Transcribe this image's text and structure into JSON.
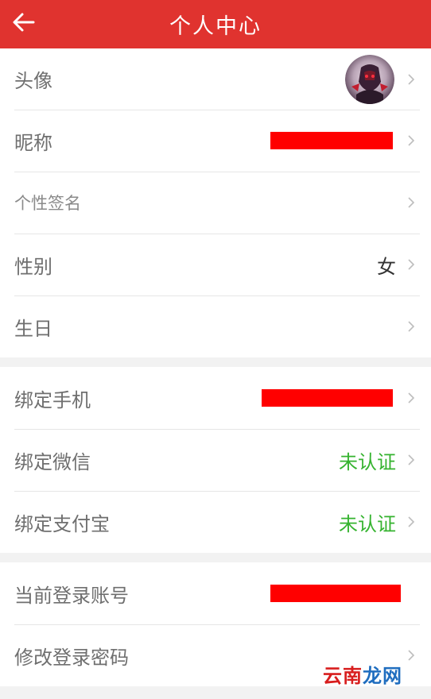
{
  "header": {
    "title": "个人中心"
  },
  "group1": [
    {
      "label": "头像",
      "type": "avatar"
    },
    {
      "label": "昵称",
      "type": "redacted"
    },
    {
      "label": "个性签名",
      "type": "empty"
    },
    {
      "label": "性别",
      "value": "女"
    },
    {
      "label": "生日",
      "type": "empty"
    }
  ],
  "group2": [
    {
      "label": "绑定手机",
      "type": "redacted"
    },
    {
      "label": "绑定微信",
      "value": "未认证"
    },
    {
      "label": "绑定支付宝",
      "value": "未认证"
    }
  ],
  "group3": [
    {
      "label": "当前登录账号",
      "type": "redacted"
    },
    {
      "label": "修改登录密码",
      "type": "empty"
    }
  ],
  "colors": {
    "header": "#e0332f",
    "accent_green": "#35b32f",
    "redaction": "#ff0000"
  },
  "icons": {
    "back": "arrow-left-icon",
    "row": "chevron-right-icon"
  },
  "watermark": {
    "part1": "云南",
    "part2": "龙网"
  }
}
